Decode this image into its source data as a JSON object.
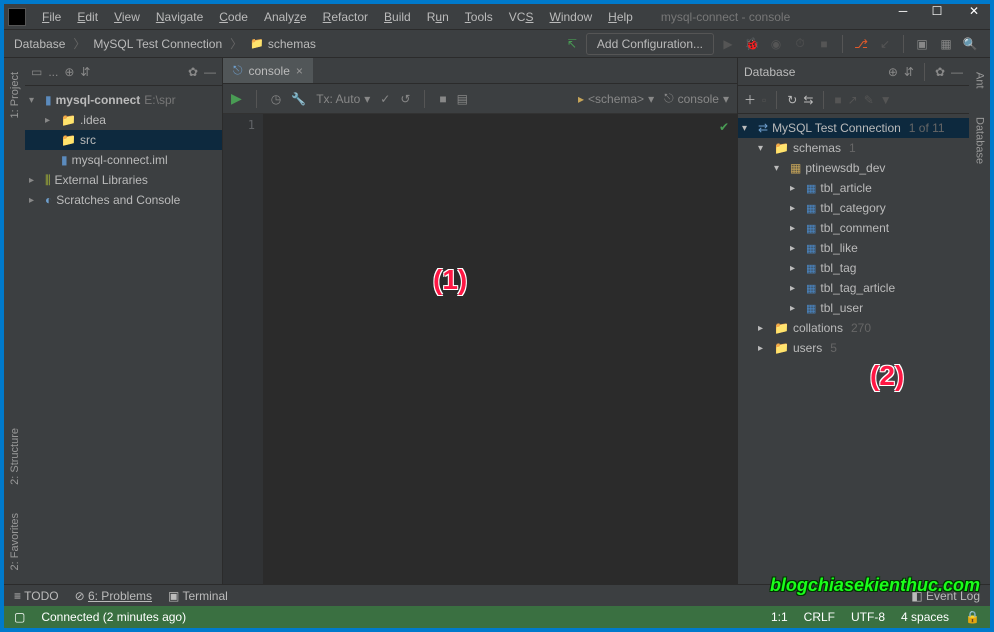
{
  "window": {
    "title": "mysql-connect - console"
  },
  "menu": [
    "File",
    "Edit",
    "View",
    "Navigate",
    "Code",
    "Analyze",
    "Refactor",
    "Build",
    "Run",
    "Tools",
    "VCS",
    "Window",
    "Help"
  ],
  "breadcrumbs": [
    "Database",
    "MySQL Test Connection",
    "schemas"
  ],
  "config_button": "Add Configuration...",
  "left_rail": [
    "1: Project",
    "2: Structure",
    "2: Favorites"
  ],
  "right_rail": [
    "Ant",
    "Database"
  ],
  "project_panel": {
    "dropdown_icon": "...",
    "root": {
      "name": "mysql-connect",
      "path": "E:\\spr"
    },
    "children": [
      {
        "icon": "folder",
        "name": ".idea",
        "indent": 1,
        "arrow": ">"
      },
      {
        "icon": "folder-src",
        "name": "src",
        "indent": 1,
        "arrow": "",
        "selected": true
      },
      {
        "icon": "file",
        "name": "mysql-connect.iml",
        "indent": 1,
        "arrow": ""
      }
    ],
    "extra": [
      {
        "icon": "lib",
        "name": "External Libraries",
        "arrow": ">"
      },
      {
        "icon": "scratch",
        "name": "Scratches and Console",
        "arrow": ">"
      }
    ]
  },
  "editor": {
    "tab": "console",
    "gutter_line": "1",
    "tx_label": "Tx: Auto",
    "schema_label": "<schema>",
    "console_label": "console",
    "annotations": {
      "a1": "(1)",
      "a2": "(2)"
    }
  },
  "database_panel": {
    "title": "Database",
    "root": {
      "name": "MySQL Test Connection",
      "count": "1 of 11"
    },
    "schemas": {
      "label": "schemas",
      "count": "1"
    },
    "db": "ptinewsdb_dev",
    "tables": [
      "tbl_article",
      "tbl_category",
      "tbl_comment",
      "tbl_like",
      "tbl_tag",
      "tbl_tag_article",
      "tbl_user"
    ],
    "collations": {
      "label": "collations",
      "count": "270"
    },
    "users": {
      "label": "users",
      "count": "5"
    }
  },
  "status": {
    "todo": "TODO",
    "problems": "6: Problems",
    "terminal": "Terminal",
    "event_log": "Event Log",
    "connected": "Connected (2 minutes ago)",
    "pos": "1:1",
    "crlf": "CRLF",
    "enc": "UTF-8",
    "indent": "4 spaces"
  },
  "watermark": "blogchiasekienthuc.com"
}
